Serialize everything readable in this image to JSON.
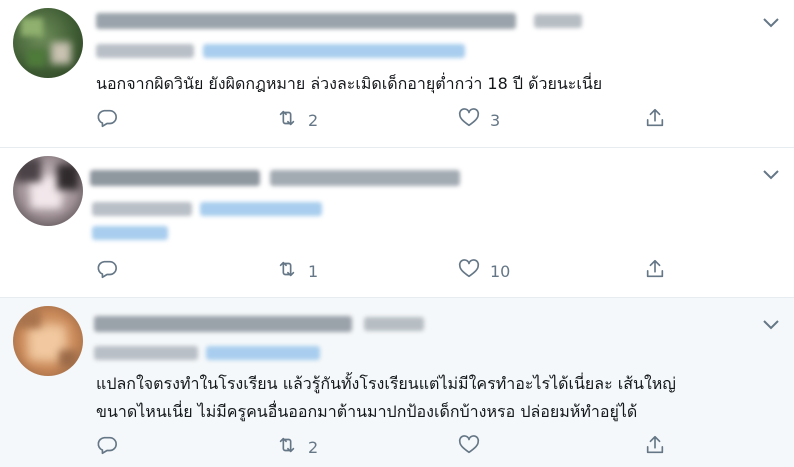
{
  "icons": {
    "reply": "reply-icon",
    "retweet": "retweet-icon",
    "like": "heart-icon",
    "share": "share-icon",
    "more": "chevron-down-icon"
  },
  "colors": {
    "action_gray": "#657786",
    "divider": "#e6ecf0",
    "highlight_bg": "#f5f8fa"
  },
  "tweets": [
    {
      "text": "นอกจากผิดวินัย ยังผิดกฎหมาย ล่วงละเมิดเด็กอายุต่ำกว่า 18 ปี ด้วยนะเนี่ย",
      "retweets": "2",
      "likes": "3"
    },
    {
      "retweets": "1",
      "likes": "10"
    },
    {
      "text_lines": [
        "แปลกใจตรงทำในโรงเรียน แล้วรู้กันทั้งโรงเรียนแต่ไม่มีใครทำอะไรได้เนี่ยละ เส้นใหญ่",
        "ขนาดไหนเนี่ย ไม่มีครูคนอื่นออกมาต้านมาปกป้องเด็กบ้างหรอ ปล่อยมห้ทำอยู่ได้"
      ],
      "retweets": "2",
      "likes": ""
    }
  ]
}
